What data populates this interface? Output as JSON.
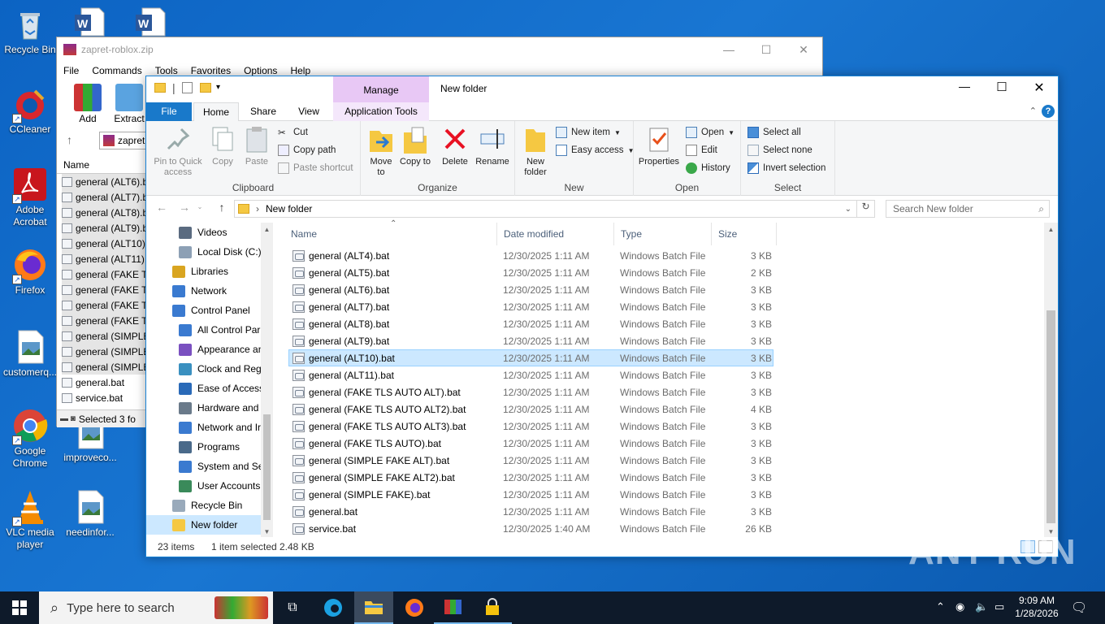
{
  "desktop": {
    "icons": [
      {
        "label": "Recycle Bin",
        "icon": "recycle-bin-icon"
      },
      {
        "label": "CCleaner",
        "icon": "ccleaner-icon"
      },
      {
        "label": "Adobe Acrobat",
        "icon": "acrobat-icon"
      },
      {
        "label": "Firefox",
        "icon": "firefox-icon"
      },
      {
        "label": "customerq...",
        "icon": "image-file-icon"
      },
      {
        "label": "Google Chrome",
        "icon": "chrome-icon"
      },
      {
        "label": "improveco...",
        "icon": "image-file-icon"
      },
      {
        "label": "VLC media player",
        "icon": "vlc-icon"
      },
      {
        "label": "needinfor...",
        "icon": "image-file-icon"
      }
    ]
  },
  "winrar": {
    "title": "zapret-roblox.zip",
    "menu": [
      "File",
      "Commands",
      "Tools",
      "Favorites",
      "Options",
      "Help"
    ],
    "toolbar": {
      "add": "Add",
      "extract": "Extract"
    },
    "path": "zapret",
    "col_name": "Name",
    "items": [
      "general (ALT6).b",
      "general (ALT7).b",
      "general (ALT8).b",
      "general (ALT9).b",
      "general (ALT10).",
      "general (ALT11).",
      "general (FAKE TL",
      "general (FAKE TL",
      "general (FAKE TL",
      "general (FAKE TL",
      "general (SIMPLE",
      "general (SIMPLE",
      "general (SIMPLE",
      "general.bat",
      "service.bat"
    ],
    "status": "Selected 3 fo"
  },
  "explorer": {
    "title": "New folder",
    "context_tab": "Manage",
    "tabs": {
      "file": "File",
      "home": "Home",
      "share": "Share",
      "view": "View",
      "app_tools": "Application Tools"
    },
    "ribbon": {
      "clipboard": {
        "label": "Clipboard",
        "pin": "Pin to Quick access",
        "copy": "Copy",
        "paste": "Paste",
        "cut": "Cut",
        "copy_path": "Copy path",
        "paste_shortcut": "Paste shortcut"
      },
      "organize": {
        "label": "Organize",
        "move_to": "Move to",
        "copy_to": "Copy to",
        "delete": "Delete",
        "rename": "Rename"
      },
      "new": {
        "label": "New",
        "new_folder": "New folder",
        "new_item": "New item",
        "easy_access": "Easy access"
      },
      "open": {
        "label": "Open",
        "properties": "Properties",
        "open": "Open",
        "edit": "Edit",
        "history": "History"
      },
      "select": {
        "label": "Select",
        "select_all": "Select all",
        "select_none": "Select none",
        "invert": "Invert selection"
      }
    },
    "address": {
      "path": "New folder",
      "search_placeholder": "Search New folder"
    },
    "nav": [
      {
        "label": "Videos",
        "icon": "videos-icon",
        "indent": 2
      },
      {
        "label": "Local Disk (C:)",
        "icon": "disk-icon",
        "indent": 2
      },
      {
        "label": "Libraries",
        "icon": "libraries-icon",
        "indent": 1
      },
      {
        "label": "Network",
        "icon": "network-icon",
        "indent": 1
      },
      {
        "label": "Control Panel",
        "icon": "control-panel-icon",
        "indent": 1
      },
      {
        "label": "All Control Par",
        "icon": "control-panel-icon",
        "indent": 2
      },
      {
        "label": "Appearance an",
        "icon": "appearance-icon",
        "indent": 2
      },
      {
        "label": "Clock and Regi",
        "icon": "clock-icon",
        "indent": 2
      },
      {
        "label": "Ease of Access",
        "icon": "ease-access-icon",
        "indent": 2
      },
      {
        "label": "Hardware and",
        "icon": "hardware-icon",
        "indent": 2
      },
      {
        "label": "Network and Ir",
        "icon": "network-icon",
        "indent": 2
      },
      {
        "label": "Programs",
        "icon": "programs-icon",
        "indent": 2
      },
      {
        "label": "System and Se",
        "icon": "system-icon",
        "indent": 2
      },
      {
        "label": "User Accounts",
        "icon": "user-accounts-icon",
        "indent": 2
      },
      {
        "label": "Recycle Bin",
        "icon": "recycle-bin-icon",
        "indent": 1
      },
      {
        "label": "New folder",
        "icon": "folder-icon",
        "indent": 1
      }
    ],
    "columns": {
      "name": "Name",
      "date": "Date modified",
      "type": "Type",
      "size": "Size"
    },
    "files": [
      {
        "name": "general (ALT4).bat",
        "date": "12/30/2025 1:11 AM",
        "type": "Windows Batch File",
        "size": "3 KB"
      },
      {
        "name": "general (ALT5).bat",
        "date": "12/30/2025 1:11 AM",
        "type": "Windows Batch File",
        "size": "2 KB"
      },
      {
        "name": "general (ALT6).bat",
        "date": "12/30/2025 1:11 AM",
        "type": "Windows Batch File",
        "size": "3 KB"
      },
      {
        "name": "general (ALT7).bat",
        "date": "12/30/2025 1:11 AM",
        "type": "Windows Batch File",
        "size": "3 KB"
      },
      {
        "name": "general (ALT8).bat",
        "date": "12/30/2025 1:11 AM",
        "type": "Windows Batch File",
        "size": "3 KB"
      },
      {
        "name": "general (ALT9).bat",
        "date": "12/30/2025 1:11 AM",
        "type": "Windows Batch File",
        "size": "3 KB"
      },
      {
        "name": "general (ALT10).bat",
        "date": "12/30/2025 1:11 AM",
        "type": "Windows Batch File",
        "size": "3 KB",
        "selected": true
      },
      {
        "name": "general (ALT11).bat",
        "date": "12/30/2025 1:11 AM",
        "type": "Windows Batch File",
        "size": "3 KB"
      },
      {
        "name": "general (FAKE TLS AUTO ALT).bat",
        "date": "12/30/2025 1:11 AM",
        "type": "Windows Batch File",
        "size": "3 KB"
      },
      {
        "name": "general (FAKE TLS AUTO ALT2).bat",
        "date": "12/30/2025 1:11 AM",
        "type": "Windows Batch File",
        "size": "4 KB"
      },
      {
        "name": "general (FAKE TLS AUTO ALT3).bat",
        "date": "12/30/2025 1:11 AM",
        "type": "Windows Batch File",
        "size": "3 KB"
      },
      {
        "name": "general (FAKE TLS AUTO).bat",
        "date": "12/30/2025 1:11 AM",
        "type": "Windows Batch File",
        "size": "3 KB"
      },
      {
        "name": "general (SIMPLE FAKE ALT).bat",
        "date": "12/30/2025 1:11 AM",
        "type": "Windows Batch File",
        "size": "3 KB"
      },
      {
        "name": "general (SIMPLE FAKE ALT2).bat",
        "date": "12/30/2025 1:11 AM",
        "type": "Windows Batch File",
        "size": "3 KB"
      },
      {
        "name": "general (SIMPLE FAKE).bat",
        "date": "12/30/2025 1:11 AM",
        "type": "Windows Batch File",
        "size": "3 KB"
      },
      {
        "name": "general.bat",
        "date": "12/30/2025 1:11 AM",
        "type": "Windows Batch File",
        "size": "3 KB"
      },
      {
        "name": "service.bat",
        "date": "12/30/2025 1:40 AM",
        "type": "Windows Batch File",
        "size": "26 KB"
      }
    ],
    "status": {
      "count": "23 items",
      "selected": "1 item selected",
      "size": "2.48 KB"
    }
  },
  "taskbar": {
    "search_placeholder": "Type here to search",
    "time": "9:09 AM",
    "date": "1/28/2026"
  },
  "watermark": "ANY RUN"
}
